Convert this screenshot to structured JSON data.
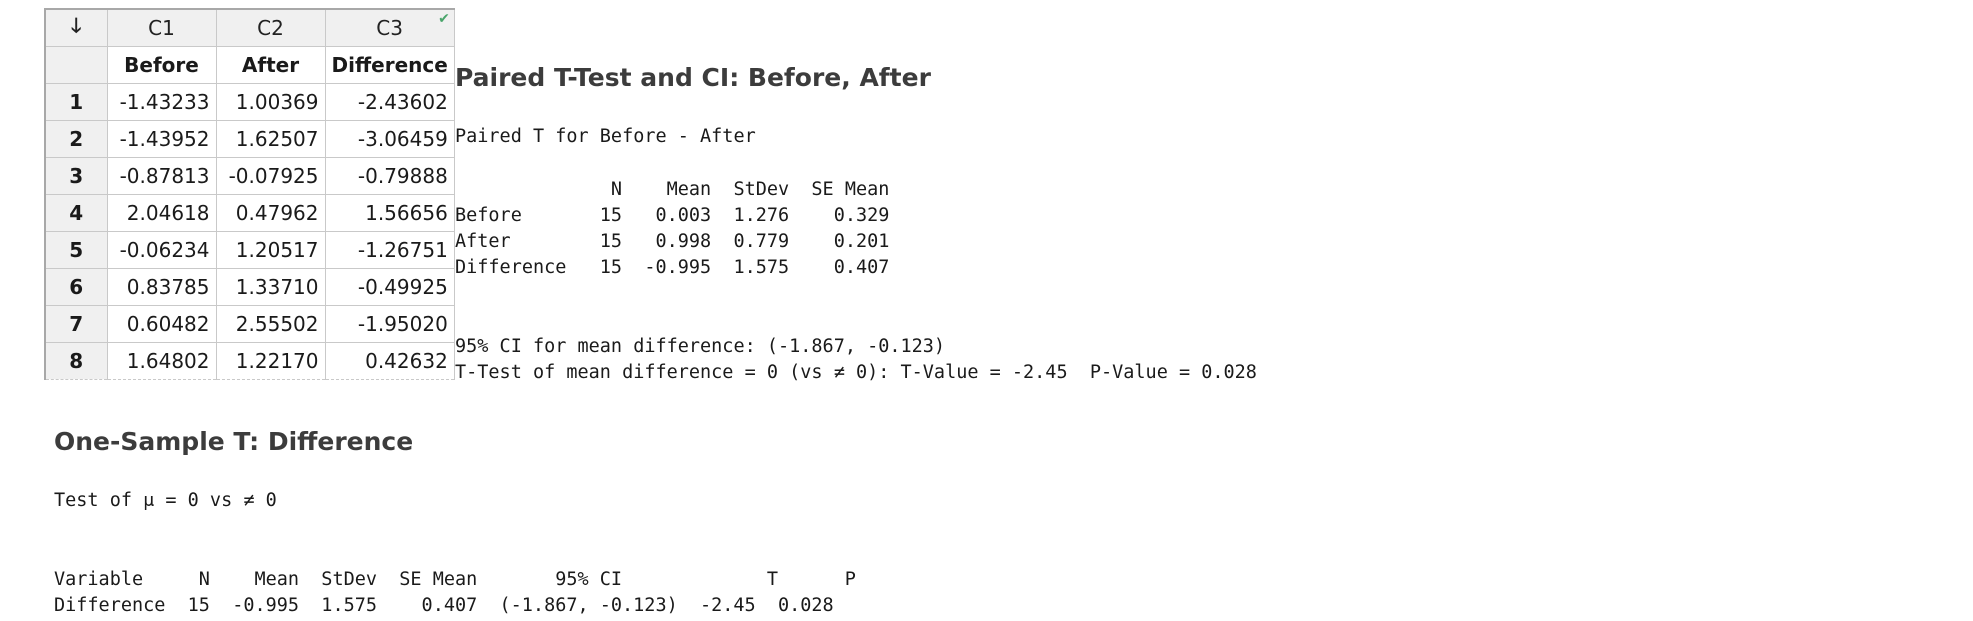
{
  "worksheet": {
    "corner_icon": "down-arrow-icon",
    "column_ids": [
      "C1",
      "C2",
      "C3"
    ],
    "column_names": [
      "Before",
      "After",
      "Difference"
    ],
    "rows": [
      {
        "index": "1",
        "before": "-1.43233",
        "after": "1.00369",
        "difference": "-2.43602"
      },
      {
        "index": "2",
        "before": "-1.43952",
        "after": "1.62507",
        "difference": "-3.06459"
      },
      {
        "index": "3",
        "before": "-0.87813",
        "after": "-0.07925",
        "difference": "-0.79888"
      },
      {
        "index": "4",
        "before": "2.04618",
        "after": "0.47962",
        "difference": "1.56656"
      },
      {
        "index": "5",
        "before": "-0.06234",
        "after": "1.20517",
        "difference": "-1.26751"
      },
      {
        "index": "6",
        "before": "0.83785",
        "after": "1.33710",
        "difference": "-0.49925"
      },
      {
        "index": "7",
        "before": "0.60482",
        "after": "2.55502",
        "difference": "-1.95020"
      },
      {
        "index": "8",
        "before": "1.64802",
        "after": "1.22170",
        "difference": "0.42632"
      }
    ],
    "formula_indicator": "check-icon"
  },
  "paired_test": {
    "title": "Paired T-Test and CI: Before, After",
    "subtitle": "Paired T for Before - After",
    "table_header": "              N    Mean  StDev  SE Mean",
    "table_rows": [
      "Before       15   0.003  1.276    0.329",
      "After        15   0.998  0.779    0.201",
      "Difference   15  -0.995  1.575    0.407"
    ],
    "ci_line": "95% CI for mean difference: (-1.867, -0.123)",
    "ttest_line": "T-Test of mean difference = 0 (vs ≠ 0): T-Value = -2.45  P-Value = 0.028"
  },
  "one_sample": {
    "title": "One-Sample T: Difference",
    "test_line": "Test of μ = 0 vs ≠ 0",
    "table_header": "Variable     N    Mean  StDev  SE Mean       95% CI             T      P",
    "table_row": "Difference  15  -0.995  1.575    0.407  (-1.867, -0.123)  -2.45  0.028"
  }
}
